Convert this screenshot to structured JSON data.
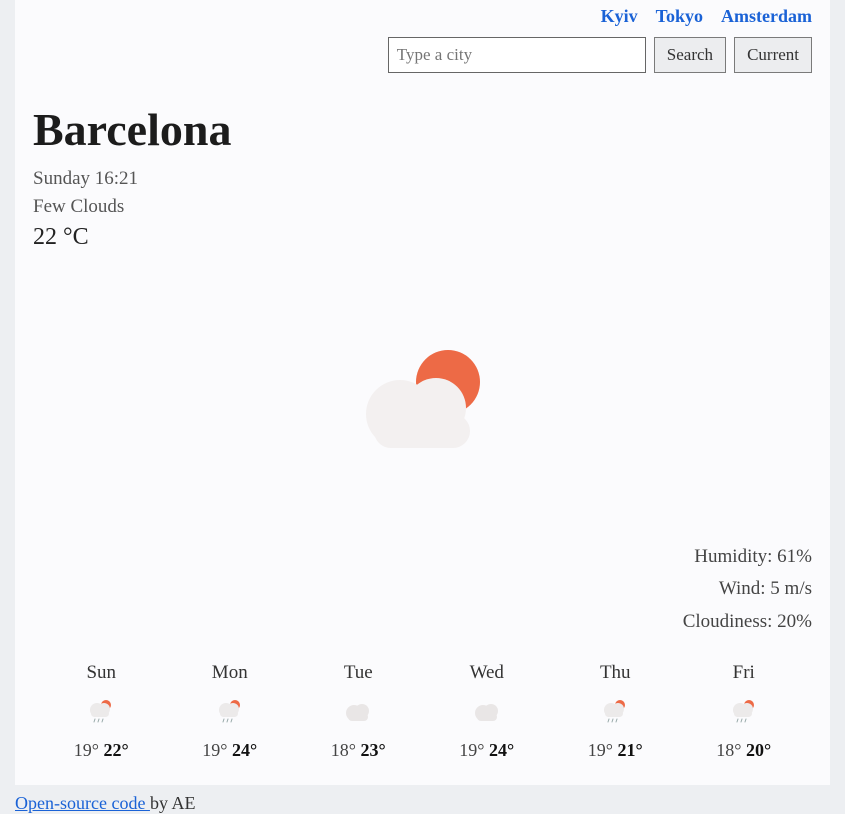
{
  "quick_links": [
    "Kyiv",
    "Tokyo",
    "Amsterdam"
  ],
  "search": {
    "placeholder": "Type a city",
    "search_label": "Search",
    "current_label": "Current"
  },
  "city": "Barcelona",
  "datetime": "Sunday 16:21",
  "condition": "Few Clouds",
  "temperature": "22 °C",
  "main_icon": "few-clouds",
  "stats": {
    "humidity": "Humidity: 61%",
    "wind": "Wind: 5 m/s",
    "cloudiness": "Cloudiness: 20%"
  },
  "forecast": [
    {
      "day": "Sun",
      "icon": "rain-sun",
      "lo": "19°",
      "hi": "22°"
    },
    {
      "day": "Mon",
      "icon": "rain-sun",
      "lo": "19°",
      "hi": "24°"
    },
    {
      "day": "Tue",
      "icon": "cloud",
      "lo": "18°",
      "hi": "23°"
    },
    {
      "day": "Wed",
      "icon": "cloud",
      "lo": "19°",
      "hi": "24°"
    },
    {
      "day": "Thu",
      "icon": "rain-sun",
      "lo": "19°",
      "hi": "21°"
    },
    {
      "day": "Fri",
      "icon": "rain-sun",
      "lo": "18°",
      "hi": "20°"
    }
  ],
  "footer": {
    "link_text": "Open-source code ",
    "suffix": "by AE"
  }
}
